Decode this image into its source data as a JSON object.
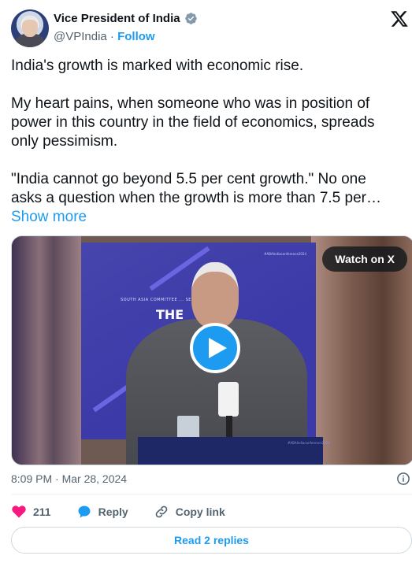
{
  "header": {
    "display_name": "Vice President of India",
    "handle": "@VPIndia",
    "separator": " · ",
    "follow_label": "Follow",
    "verified_color": "#829aab"
  },
  "tweet": {
    "paragraphs": [
      "India's growth is marked with economic rise.",
      "My heart pains, when someone who was in position of power in this country in the field of economics, spreads only pessimism.",
      "\"India cannot go beyond 5.5 per cent growth.\" No one asks a question when the growth is more than 7.5 per…"
    ],
    "show_more_label": "Show more"
  },
  "media": {
    "watch_label": "Watch on X",
    "banner_line": "SOUTH ASIA COMMITTEE ... SECTION",
    "banner_title": "THE",
    "banner_tag": "#ABAIndiaconference2024",
    "podium_text": "#ABAIndiaconference2024"
  },
  "meta": {
    "timestamp": "8:09 PM · Mar 28, 2024"
  },
  "actions": {
    "like_count": "211",
    "reply_label": "Reply",
    "copy_label": "Copy link"
  },
  "footer": {
    "read_replies_label": "Read 2 replies"
  },
  "colors": {
    "accent": "#1d9bf0",
    "like": "#f91880",
    "text": "#0f1419",
    "muted": "#536471"
  },
  "icons": [
    "verified-badge-icon",
    "x-logo-icon",
    "play-icon",
    "info-icon",
    "heart-icon",
    "reply-bubble-icon",
    "link-icon"
  ]
}
